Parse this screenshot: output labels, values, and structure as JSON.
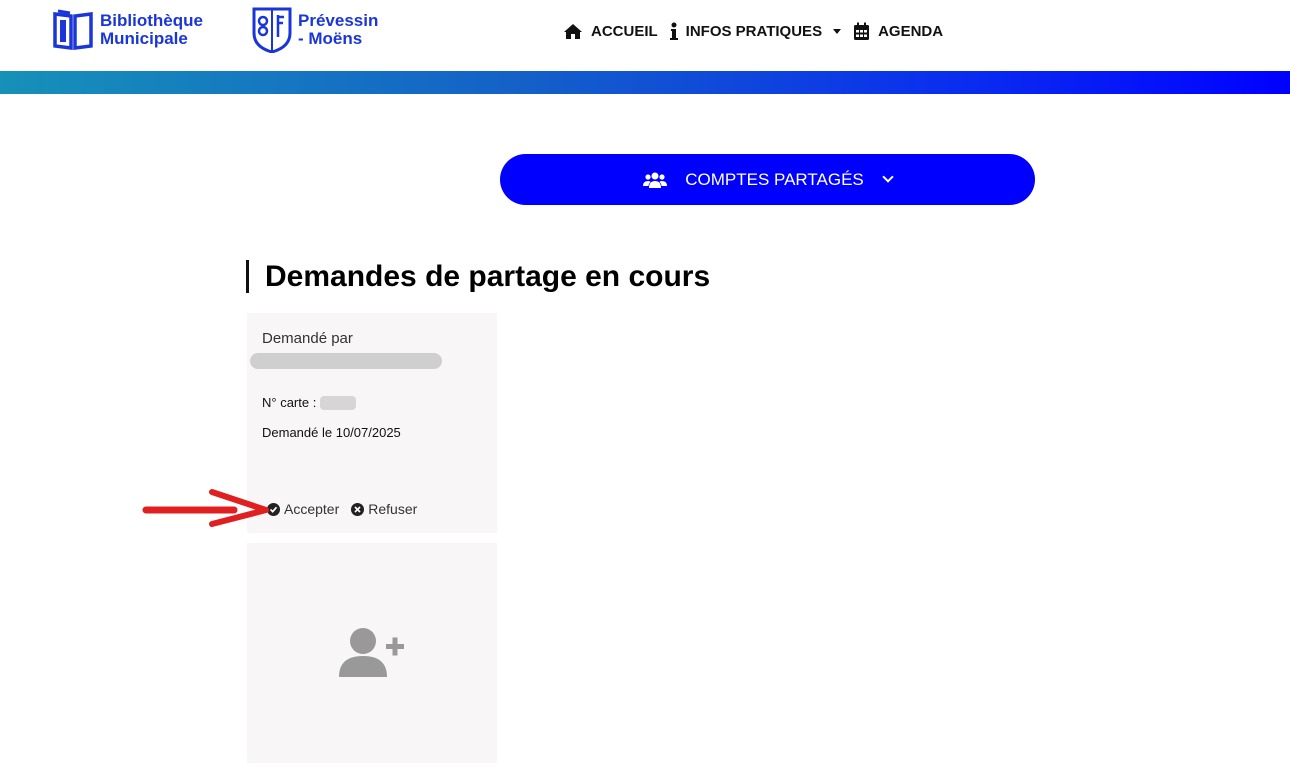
{
  "header": {
    "logo_biblio": {
      "line1": "Bibliothèque",
      "line2": "Municipale"
    },
    "logo_city": {
      "line1": "Prévessin",
      "line2": "- Moëns"
    },
    "nav": [
      {
        "label": "ACCUEIL",
        "icon": "home-icon"
      },
      {
        "label": "INFOS PRATIQUES",
        "icon": "info-icon"
      },
      {
        "label": "AGENDA",
        "icon": "calendar-icon"
      }
    ]
  },
  "comptes": {
    "label": "COMPTES PARTAGÉS",
    "icon": "users-icon"
  },
  "section_title": "Demandes de partage en cours",
  "request_card": {
    "requested_by_label": "Demandé par",
    "card_number_label": "N° carte :",
    "date_text": "Demandé le 10/07/2025",
    "accept_label": "Accepter",
    "refuse_label": "Refuser"
  },
  "add_card": {
    "icon": "add-user-icon"
  },
  "colors": {
    "brand_blue": "#0000ff",
    "logo_blue": "#1a36d8",
    "card_bg": "#f8f6f6",
    "annotation_red": "#e02020"
  }
}
